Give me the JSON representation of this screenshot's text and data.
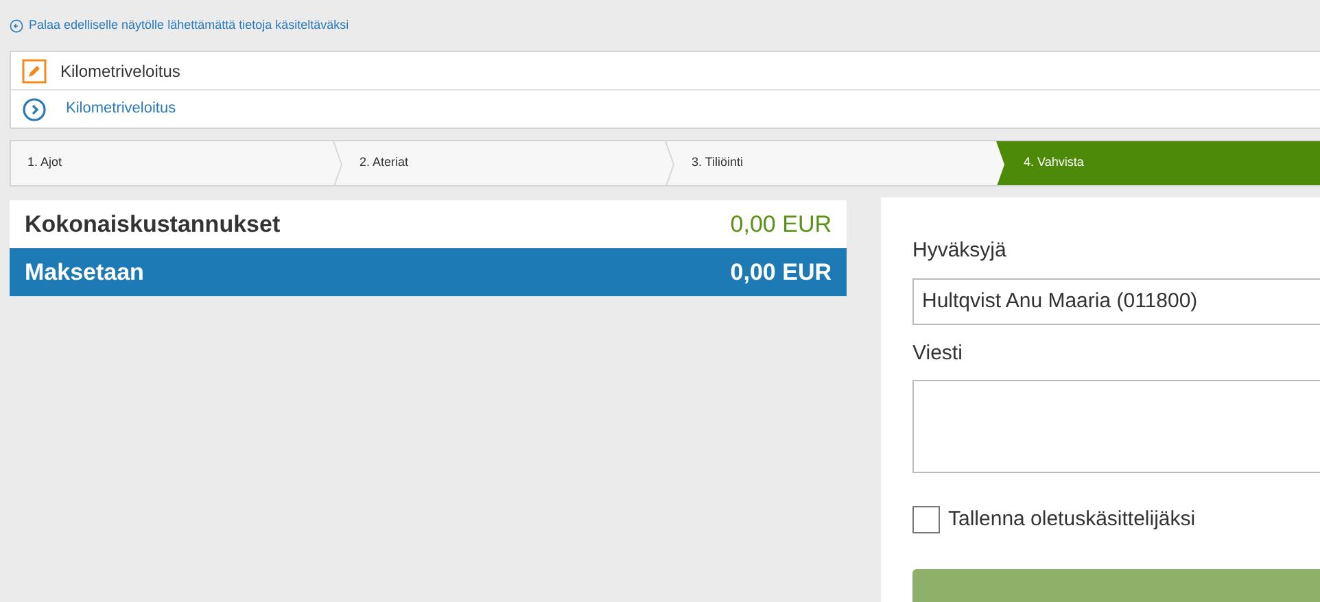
{
  "back_link": "Palaa edelliselle näytölle lähettämättä tietoja käsiteltäväksi",
  "header": {
    "title": "Kilometriveloitus",
    "subtitle": "Kilometriveloitus"
  },
  "steps": [
    {
      "label": "1. Ajot",
      "selected": false
    },
    {
      "label": "2. Ateriat",
      "selected": false
    },
    {
      "label": "3. Tiliöinti",
      "selected": false
    },
    {
      "label": "4. Vahvista",
      "selected": true
    }
  ],
  "totals": [
    {
      "label": "Kokonaiskustannukset",
      "amount": "0,00 EUR",
      "kind": "total"
    },
    {
      "label": "Maksetaan",
      "amount": "0,00 EUR",
      "kind": "payable"
    }
  ],
  "form": {
    "approver_label": "Hyväksyjä",
    "approver_value": "Hultqvist Anu Maaria (011800)",
    "message_label": "Viesti",
    "save_default": {
      "label": "Tallenna oletuskäsittelijäksi",
      "checked": false
    }
  }
}
